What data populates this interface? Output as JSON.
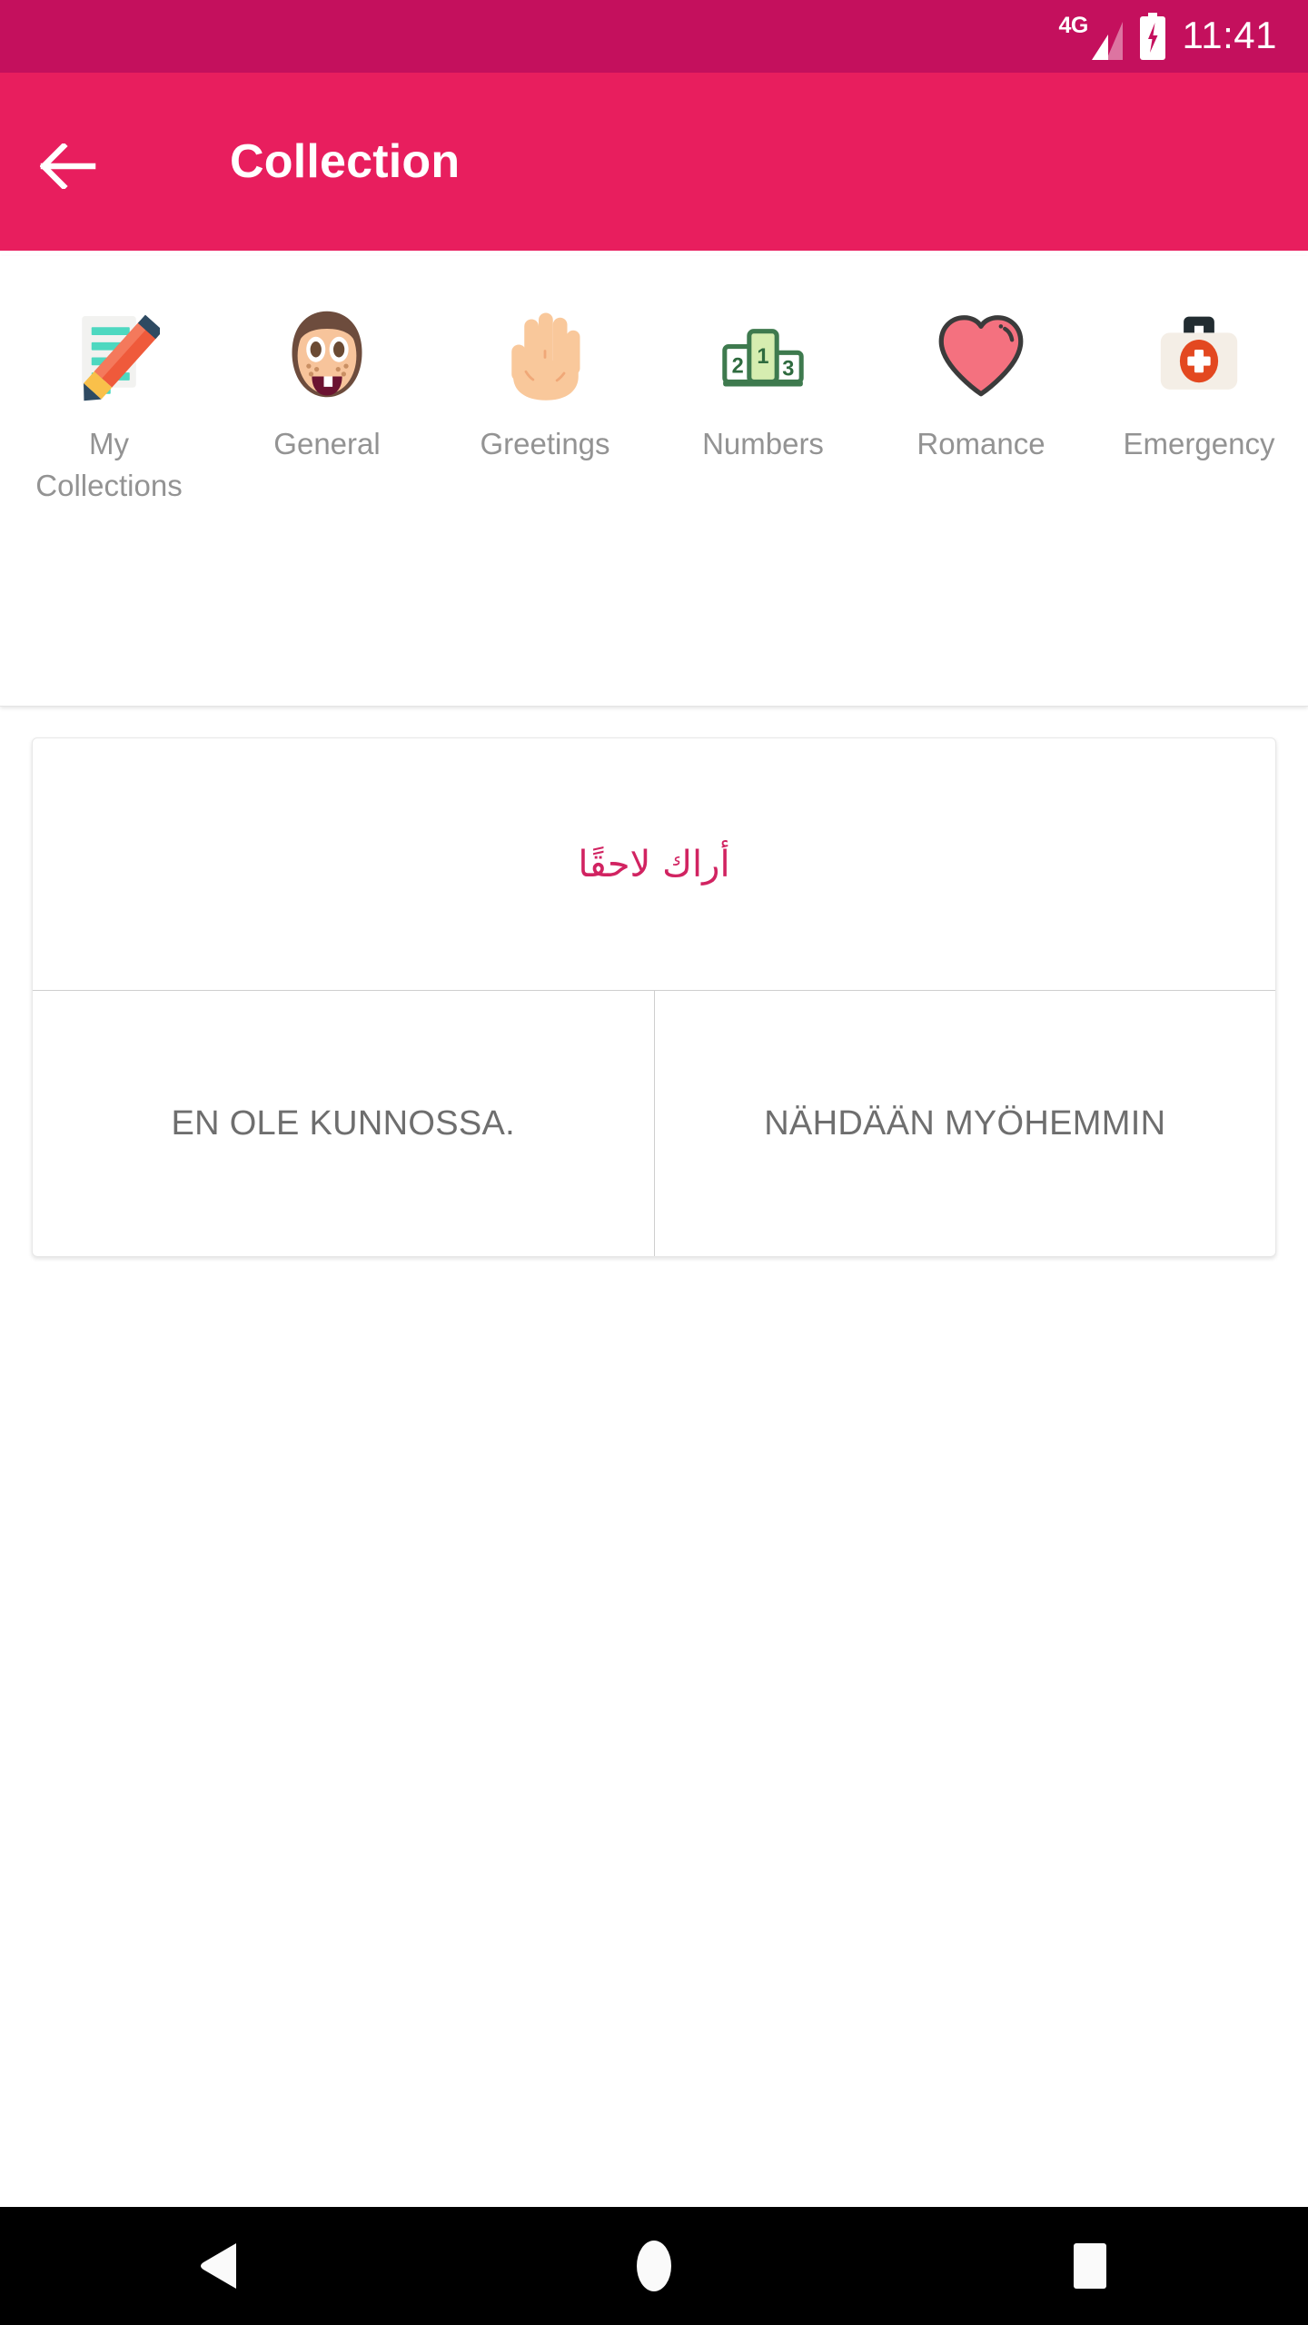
{
  "status_bar": {
    "network_type": "4G",
    "battery_state": "charging",
    "time": "11:41",
    "background_color": "#C4105D",
    "icons": [
      "signal-icon",
      "battery-charging-icon"
    ]
  },
  "app_bar": {
    "title": "Collection",
    "back_icon": "arrow-left-icon",
    "background_color": "#E81E5E",
    "text_color": "#FFFFFF"
  },
  "categories": {
    "expand_icon": "chevron-down-icon",
    "label_color": "#939393",
    "items": [
      {
        "label": "My Collections",
        "icon": "memo-pencil-icon"
      },
      {
        "label": "General",
        "icon": "girl-face-icon"
      },
      {
        "label": "Greetings",
        "icon": "raised-hand-icon"
      },
      {
        "label": "Numbers",
        "icon": "podium-icon"
      },
      {
        "label": "Romance",
        "icon": "heart-icon"
      },
      {
        "label": "Emergency",
        "icon": "first-aid-kit-icon"
      }
    ]
  },
  "phrase_card": {
    "arabic_text": "أراك لاحقًا",
    "arabic_color": "#D12361",
    "actions": [
      {
        "label": "EN OLE KUNNOSSA."
      },
      {
        "label": "NÄHDÄÄN MYÖHEMMIN"
      }
    ],
    "action_text_color": "#6E6E6E"
  },
  "nav_bar": {
    "background_color": "#000000",
    "keys": [
      {
        "name": "back",
        "icon": "triangle-back-icon"
      },
      {
        "name": "home",
        "icon": "circle-home-icon"
      },
      {
        "name": "recents",
        "icon": "square-recents-icon"
      }
    ]
  }
}
